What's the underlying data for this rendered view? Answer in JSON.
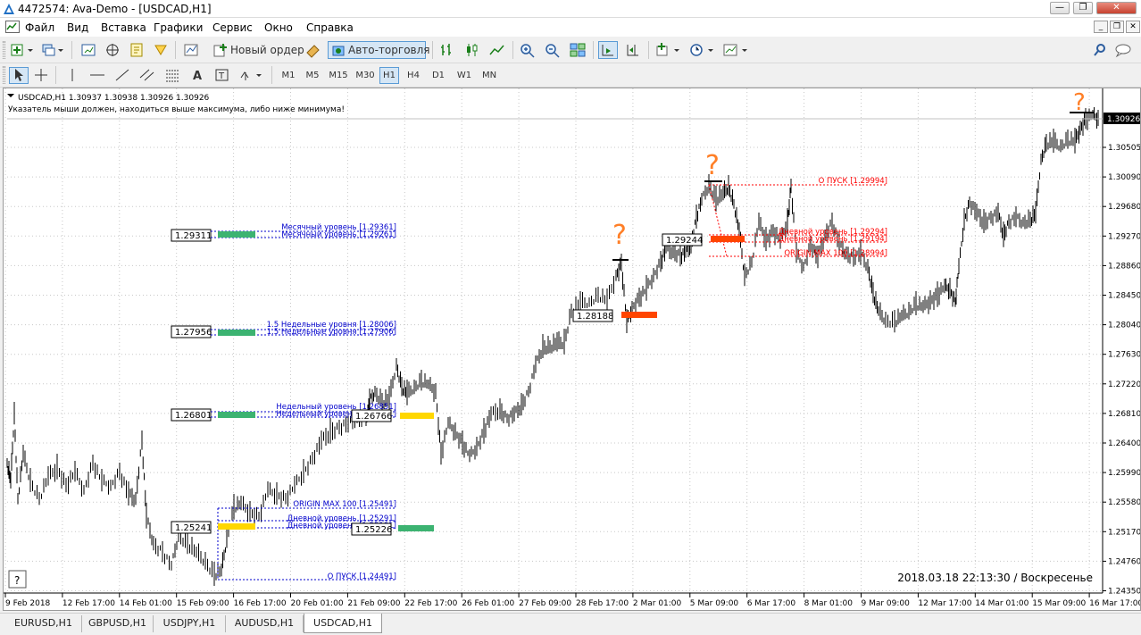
{
  "window": {
    "title": "4472574: Ava-Demo - [USDCAD,H1]",
    "minimize": "—",
    "restore": "❐",
    "close": "✕"
  },
  "menu": [
    "Файл",
    "Вид",
    "Вставка",
    "Графики",
    "Сервис",
    "Окно",
    "Справка"
  ],
  "mdi": {
    "minimize": "_",
    "restore": "❐",
    "close": "✕"
  },
  "toolbar": {
    "new_order": "Новый ордер",
    "auto_trading": "Авто-торговля"
  },
  "timeframes": [
    "M1",
    "M5",
    "M15",
    "M30",
    "H1",
    "H4",
    "D1",
    "W1",
    "MN"
  ],
  "active_timeframe": "H1",
  "chart": {
    "header": "USDCAD,H1  1.30937 1.30938 1.30926 1.30926",
    "warning": "Указатель мыши должен, находиться выше максимума, либо ниже минимума!",
    "current_price": "1.30926",
    "datetime": "2018.03.18 22:13:30 / Воскресенье",
    "help_button": "?",
    "price_axis": [
      "1.30505",
      "1.30090",
      "1.29680",
      "1.29270",
      "1.28860",
      "1.28450",
      "1.28040",
      "1.27630",
      "1.27220",
      "1.26810",
      "1.26400",
      "1.25990",
      "1.25580",
      "1.25170",
      "1.24760",
      "1.24350"
    ],
    "time_axis": [
      "9 Feb 2018",
      "12 Feb 17:00",
      "14 Feb 01:00",
      "15 Feb 09:00",
      "16 Feb 17:00",
      "20 Feb 01:00",
      "21 Feb 09:00",
      "22 Feb 17:00",
      "26 Feb 01:00",
      "27 Feb 09:00",
      "28 Feb 17:00",
      "2 Mar 01:00",
      "5 Mar 09:00",
      "6 Mar 17:00",
      "8 Mar 01:00",
      "9 Mar 09:00",
      "12 Mar 17:00",
      "14 Mar 01:00",
      "15 Mar 09:00",
      "16 Mar 17:00"
    ],
    "left_levels": [
      {
        "price": "1.29311",
        "label1": "Месячный уровень [1.29361]",
        "label2": "Месячный уровень [1.29261]"
      },
      {
        "price": "1.27956",
        "label1": "1.5 Недельные уровня [1.28006]",
        "label2": "1.5 Недельные уровня [1.27906]"
      },
      {
        "price": "1.26801",
        "label1": "Недельный уровень [1.26851]",
        "label2": "Недельный уровень [1.26751]"
      }
    ],
    "bottom_box": {
      "price": "1.25241",
      "price2": "1.25226",
      "origin": "ORIGIN MAX 100 [1.25491]",
      "day1": "Дневной уровень [1.25291]",
      "day2": "Дневной уровень [1.25191]",
      "pusk": "О    ПУСК [1.24491]"
    },
    "mid_box": {
      "price": "1.26766"
    },
    "box_128": {
      "price": "1.28188"
    },
    "top_box": {
      "price": "1.29244",
      "pusk": "О    ПУСК [1.29994]",
      "day1": "Дневной уровень [1.29294]",
      "day2": "Дневной уровень [1.29194]",
      "origin": "ORIGIN MAX 100 [1.28994]"
    },
    "annotations": [
      "?",
      "?",
      "?"
    ]
  },
  "tabs": [
    "EURUSD,H1",
    "GBPUSD,H1",
    "USDJPY,H1",
    "AUDUSD,H1",
    "USDCAD,H1"
  ],
  "active_tab": "USDCAD,H1",
  "colors": {
    "level_blue": "#0000cc",
    "level_red": "#ff0000",
    "green_bar": "#3cb371",
    "yellow_bar": "#ffd700",
    "orange_bar": "#ff4500",
    "annotation": "#ff7f27"
  }
}
